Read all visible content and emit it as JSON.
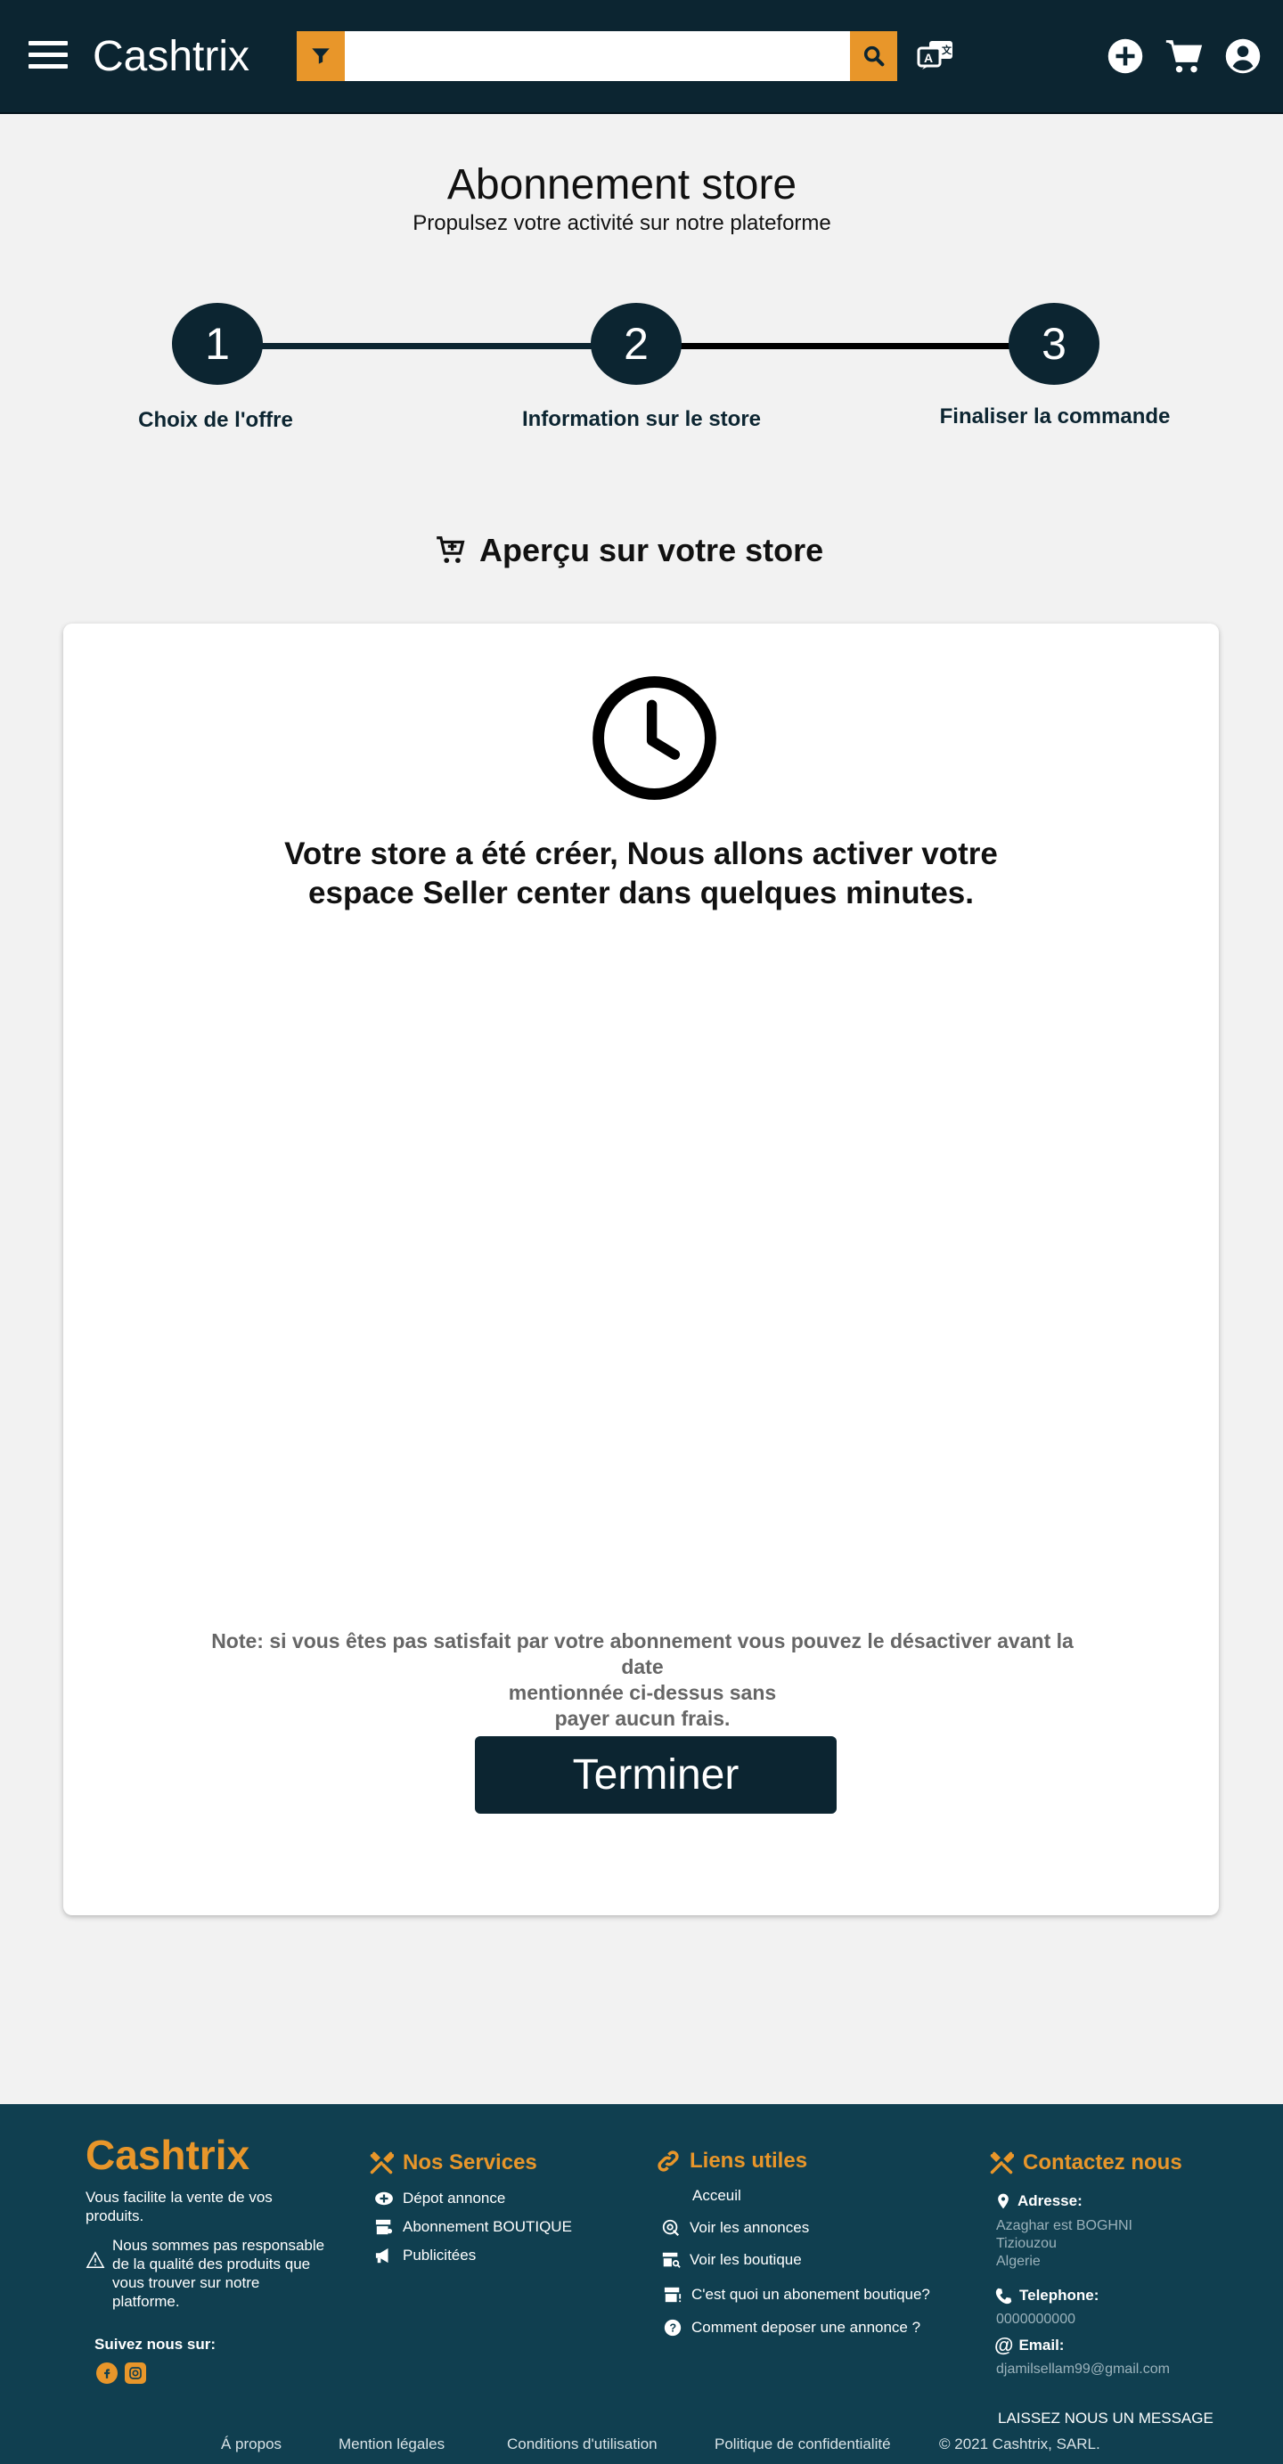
{
  "header": {
    "logo": "Cashtrix",
    "search": {
      "value": "",
      "placeholder": ""
    }
  },
  "page": {
    "title": "Abonnement store",
    "subtitle": "Propulsez votre activité sur notre plateforme"
  },
  "stepper": {
    "steps": [
      {
        "number": "1",
        "label": "Choix de l'offre"
      },
      {
        "number": "2",
        "label": "Information sur le store"
      },
      {
        "number": "3",
        "label": "Finaliser la commande"
      }
    ]
  },
  "section": {
    "heading": "Aperçu sur votre store"
  },
  "card": {
    "message_line1": "Votre store a été créer, Nous allons activer votre",
    "message_line2": "espace Seller center dans quelques minutes.",
    "note_line1": "Note: si vous êtes pas satisfait par votre abonnement vous pouvez le désactiver avant la date",
    "note_line2": "mentionnée ci-dessus sans",
    "note_line3": "payer aucun frais.",
    "button": "Terminer"
  },
  "footer": {
    "brand": "Cashtrix",
    "tagline": "Vous facilite la vente de vos produits.",
    "disclaimer": "Nous sommes pas responsable de la qualité des produits que vous trouver sur notre platforme.",
    "follow": "Suivez nous sur:",
    "services": {
      "title": "Nos Services",
      "items": [
        "Dépot annonce",
        "Abonnement BOUTIQUE",
        "Publicitées"
      ]
    },
    "links": {
      "title": "Liens utiles",
      "items": [
        "Acceuil",
        "Voir les annonces",
        "Voir les boutique",
        "C'est quoi un abonement boutique?",
        "Comment deposer une annonce ?"
      ]
    },
    "contact": {
      "title": "Contactez nous",
      "address_label": "Adresse:",
      "address_line1": "Azaghar est BOGHNI",
      "address_line2": "Tiziouzou",
      "address_line3": "Algerie",
      "phone_label": "Telephone:",
      "phone": "0000000000",
      "email_label": "Email:",
      "email": "djamilsellam99@gmail.com",
      "message_link": "LAISSEZ NOUS UN MESSAGE"
    },
    "bottom": {
      "about": "Á propos",
      "legal": "Mention légales",
      "terms": "Conditions d'utilisation",
      "privacy": "Politique de confidentialité",
      "copyright": "© 2021 Cashtrix, SARL."
    }
  },
  "colors": {
    "navy": "#0c2531",
    "accent": "#e8962a",
    "footer": "#103f50"
  }
}
